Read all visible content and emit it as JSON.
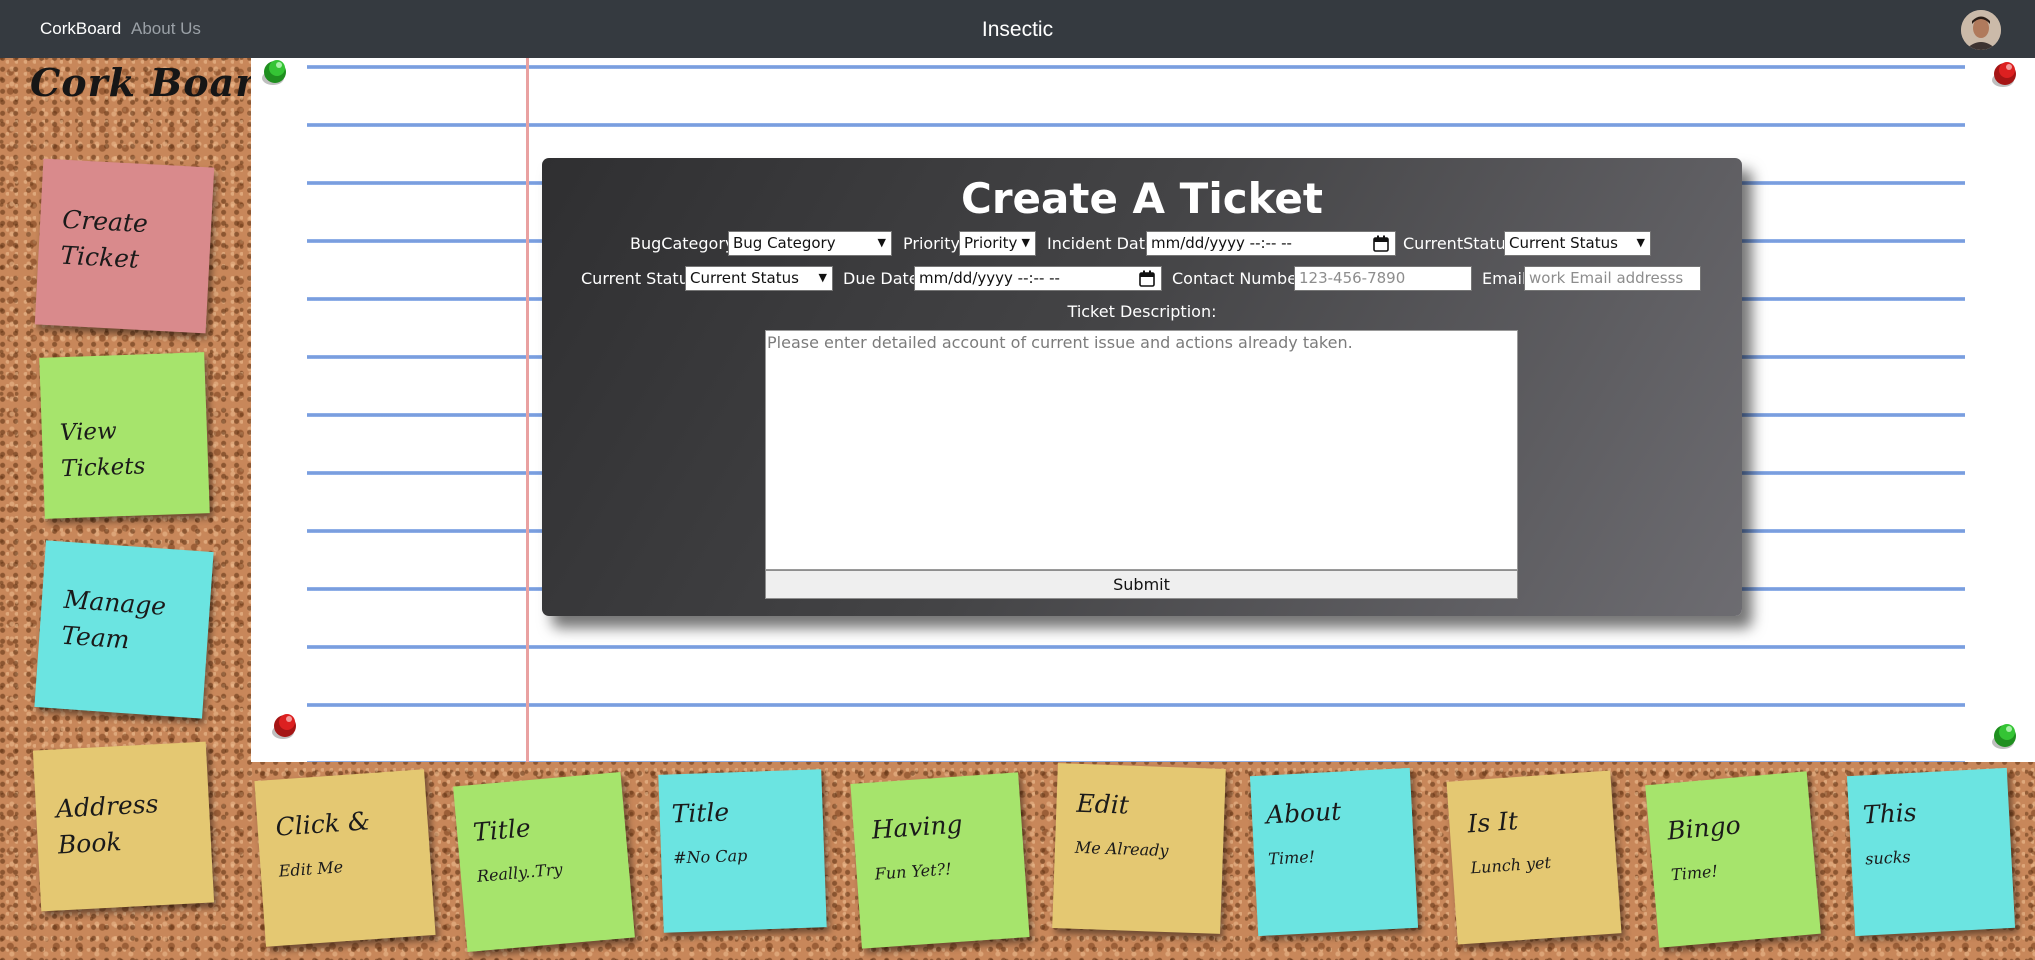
{
  "navbar": {
    "brand": "CorkBoard",
    "about": "About Us",
    "title": "Insectic"
  },
  "board": {
    "title": "Cork Board"
  },
  "side_notes": [
    {
      "label": "Create\nTicket",
      "color": "#d98a8c"
    },
    {
      "label": "View Tickets",
      "color": "#a6e46c"
    },
    {
      "label": "Manage\nTeam",
      "color": "#6be4e1"
    },
    {
      "label": "Address\nBook",
      "color": "#e4c872"
    }
  ],
  "bottom_notes": [
    {
      "title": "Click &",
      "text": "Edit Me",
      "color": "#e4c872"
    },
    {
      "title": "Title",
      "text": "Really..Try",
      "color": "#a6e46c"
    },
    {
      "title": "Title",
      "text": "#No Cap",
      "color": "#6be4e1"
    },
    {
      "title": "Having",
      "text": "Fun Yet?!",
      "color": "#a6e46c"
    },
    {
      "title": "Edit",
      "text": "Me Already",
      "color": "#e4c872"
    },
    {
      "title": "About",
      "text": "Time!",
      "color": "#6be4e1"
    },
    {
      "title": "Is It",
      "text": "Lunch yet",
      "color": "#e4c872"
    },
    {
      "title": "Bingo",
      "text": "Time!",
      "color": "#a6e46c"
    },
    {
      "title": "This",
      "text": "sucks",
      "color": "#6be4e1"
    }
  ],
  "ticket_form": {
    "title": "Create A Ticket",
    "bug_category_label": "BugCategory",
    "bug_category_value": "Bug Category",
    "priority_label": "Priority",
    "priority_value": "Priority",
    "incident_date_label": "Incident Date",
    "incident_date_value": "mm/dd/yyyy --:-- --",
    "current_status_label_1": "CurrentStatus",
    "current_status_value_1": "Current Status",
    "current_status_label_2": "Current Status",
    "current_status_value_2": "Current Status",
    "due_date_label": "Due Date",
    "due_date_value": "mm/dd/yyyy --:-- --",
    "contact_label": "Contact Number",
    "contact_placeholder": "123-456-7890",
    "email_label": "Email",
    "email_placeholder": "work Email addresss",
    "description_label": "Ticket Description:",
    "description_placeholder": "Please enter detailed account of current issue and actions already taken.",
    "submit_label": "Submit"
  },
  "colors": {
    "navbar": "#353a40",
    "pushpin_green": "#2fb52f",
    "pushpin_red": "#d21d1d",
    "paper_line": "#6f95d9",
    "margin_line": "#e9a1a1"
  },
  "icons": [
    "user-avatar",
    "pushpin-icon",
    "calendar-icon",
    "chevron-down-icon"
  ]
}
